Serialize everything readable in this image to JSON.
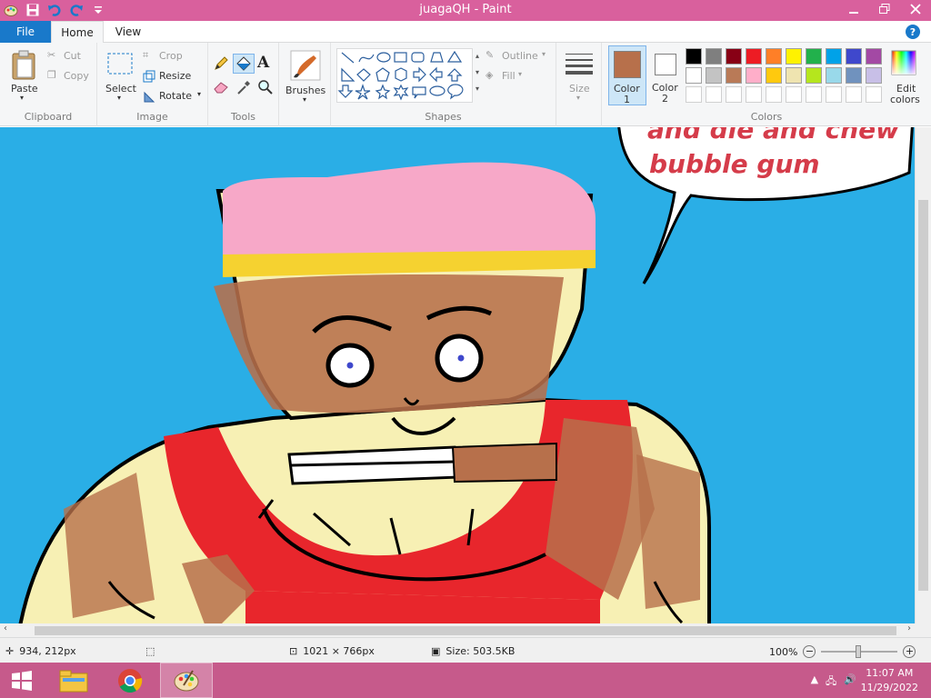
{
  "window": {
    "title": "juagaQH - Paint"
  },
  "tabs": {
    "file": "File",
    "home": "Home",
    "view": "View"
  },
  "clipboard": {
    "paste": "Paste",
    "cut": "Cut",
    "copy": "Copy",
    "label": "Clipboard"
  },
  "image": {
    "select": "Select",
    "crop": "Crop",
    "resize": "Resize",
    "rotate": "Rotate",
    "label": "Image"
  },
  "tools": {
    "label": "Tools"
  },
  "brushes": {
    "label": "Brushes"
  },
  "shapes": {
    "outline": "Outline",
    "fill": "Fill",
    "label": "Shapes"
  },
  "size": {
    "label": "Size"
  },
  "colors": {
    "color1_label": "Color",
    "color1_num": "1",
    "color2_label": "Color",
    "color2_num": "2",
    "edit_label": "Edit",
    "edit_label2": "colors",
    "label": "Colors",
    "color1": "#b7704b",
    "color2": "#ffffff",
    "palette_row1": [
      "#000000",
      "#7f7f7f",
      "#880015",
      "#ed1c24",
      "#ff7f27",
      "#fff200",
      "#22b14c",
      "#00a2e8",
      "#3f48cc",
      "#a349a4"
    ],
    "palette_row2": [
      "#ffffff",
      "#c3c3c3",
      "#b97a57",
      "#ffaec9",
      "#ffc90e",
      "#efe4b0",
      "#b5e61d",
      "#99d9ea",
      "#7092be",
      "#c8bfe7"
    ],
    "palette_row3": [
      "#ffffff",
      "#ffffff",
      "#ffffff",
      "#ffffff",
      "#ffffff",
      "#ffffff",
      "#ffffff",
      "#ffffff",
      "#ffffff",
      "#ffffff"
    ]
  },
  "canvas": {
    "text_line1": "and die and chew",
    "text_line2": "bubble gum",
    "background": "#2aaee6"
  },
  "status": {
    "cursor": "934, 212px",
    "dimensions": "1021 × 766px",
    "size": "Size: 503.5KB",
    "zoom": "100%"
  },
  "taskbar": {
    "time": "11:07 AM",
    "date": "11/29/2022"
  }
}
